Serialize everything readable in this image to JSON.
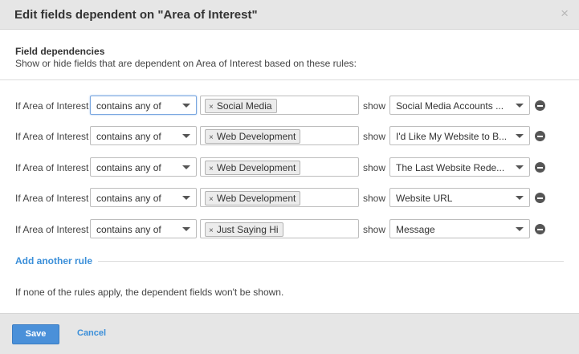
{
  "dialog": {
    "title": "Edit fields dependent on \"Area of Interest\"",
    "close_icon": "close-icon",
    "close_glyph": "×"
  },
  "section": {
    "title": "Field dependencies",
    "description": "Show or hide fields that are dependent on Area of Interest based on these rules:"
  },
  "rules": [
    {
      "prefix": "If Area of Interest",
      "operator": "contains any of",
      "tag": "Social Media",
      "show_label": "show",
      "field": "Social Media Accounts ..."
    },
    {
      "prefix": "If Area of Interest",
      "operator": "contains any of",
      "tag": "Web Development",
      "show_label": "show",
      "field": "I'd Like My Website to B..."
    },
    {
      "prefix": "If Area of Interest",
      "operator": "contains any of",
      "tag": "Web Development",
      "show_label": "show",
      "field": "The Last Website Rede..."
    },
    {
      "prefix": "If Area of Interest",
      "operator": "contains any of",
      "tag": "Web Development",
      "show_label": "show",
      "field": "Website URL"
    },
    {
      "prefix": "If Area of Interest",
      "operator": "contains any of",
      "tag": "Just Saying Hi",
      "show_label": "show",
      "field": "Message"
    }
  ],
  "tag_remove_glyph": "×",
  "add_rule_label": "Add another rule",
  "note": "If none of the rules apply, the dependent fields won't be shown.",
  "footer": {
    "save_label": "Save",
    "cancel_label": "Cancel"
  },
  "colors": {
    "accent": "#3b8fd9",
    "save_button": "#4a90d9",
    "header_bg": "#e6e6e6"
  }
}
